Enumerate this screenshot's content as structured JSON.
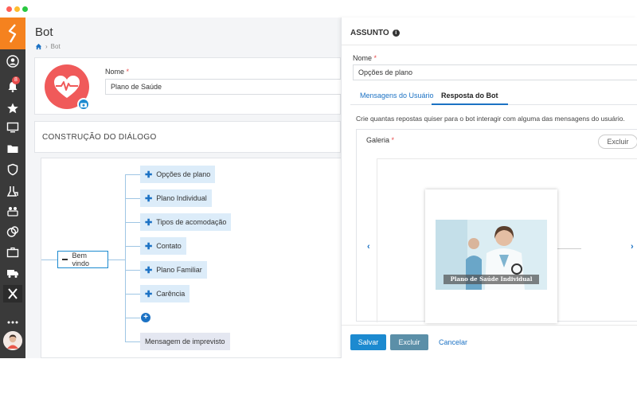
{
  "page": {
    "title": "Bot",
    "breadcrumb": "Bot"
  },
  "sidebar": {
    "notification_badge": "8"
  },
  "form": {
    "name_label": "Nome",
    "required_mark": "*",
    "name_value": "Plano de Saúde"
  },
  "dialog_section": {
    "title": "CONSTRUÇÃO DO DIÁLOGO",
    "root_label": "Bem vindo",
    "nodes": [
      "Opções de plano",
      "Plano Individual",
      "Tipos de acomodação",
      "Contato",
      "Plano Familiar",
      "Carência"
    ],
    "fallback_node": "Mensagem de imprevisto"
  },
  "panel": {
    "title": "ASSUNTO",
    "name_label": "Nome",
    "name_value": "Opções de plano",
    "tabs": [
      "Mensagens do Usuário",
      "Resposta do Bot"
    ],
    "active_tab": "Resposta do Bot",
    "description": "Crie quantas repostas quiser para o bot interagir com alguma das mensagens do usuário.",
    "gallery_label": "Galeria",
    "gallery_delete": "Excluir",
    "slide_caption": "Plano de Saúde Individual",
    "buttons": {
      "save": "Salvar",
      "delete": "Excluir",
      "cancel": "Cancelar"
    }
  },
  "colors": {
    "accent": "#1c8ad0",
    "sidebar_bg": "#3a3a3a",
    "logo_bg": "#f5821f",
    "avatar_bg": "#f05a5a"
  }
}
